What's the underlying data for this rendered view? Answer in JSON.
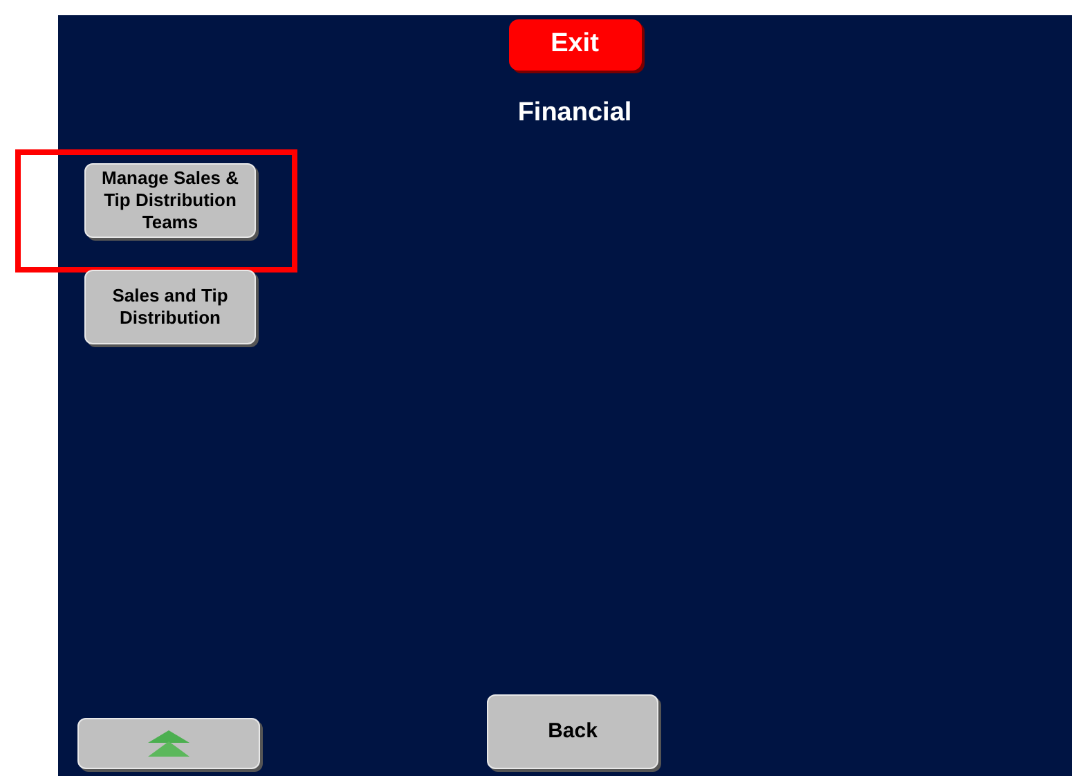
{
  "exit_button": {
    "label": "Exit"
  },
  "title": "Financial",
  "menu": [
    {
      "label": "Manage Sales & Tip Distribution Teams",
      "highlighted": true
    },
    {
      "label": "Sales and Tip Distribution",
      "highlighted": false
    }
  ],
  "back_button": {
    "label": "Back"
  }
}
